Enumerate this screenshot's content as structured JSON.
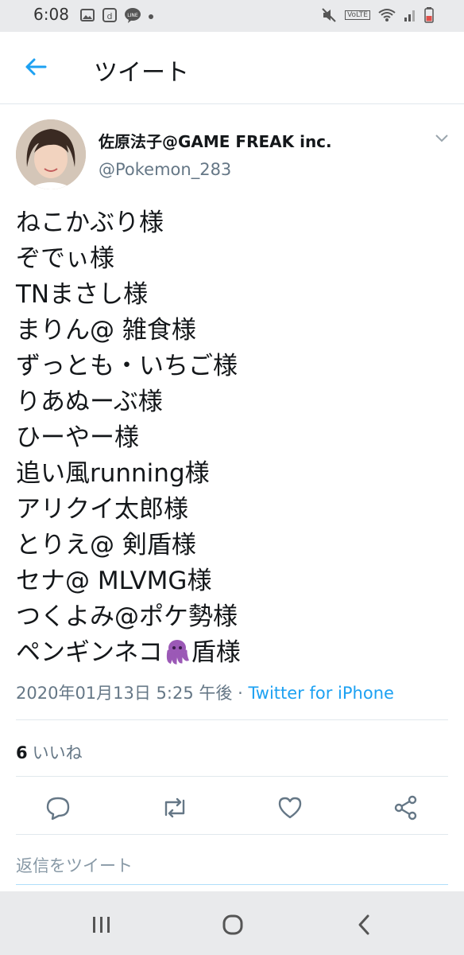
{
  "status_bar": {
    "time": "6:08",
    "left_icons": [
      "image-icon",
      "d-app-icon",
      "line-app-icon",
      "dot-icon"
    ],
    "right_icons": [
      "mute-icon",
      "volte-icon",
      "wifi-icon",
      "signal-icon",
      "battery-icon"
    ],
    "volte_label": "VoLTE"
  },
  "app_bar": {
    "title": "ツイート"
  },
  "tweet": {
    "author_name": "佐原法子@GAME FREAK inc.",
    "author_handle": "@Pokemon_283",
    "lines": [
      "ねこかぶり様",
      "ぞでぃ様",
      "TNまさし様",
      "まりん@ 雑食様",
      "ずっとも・いちご様",
      "りあぬーぶ様",
      "ひーやー様",
      "追い風running様",
      "アリクイ太郎様",
      "とりえ@ 剣盾様",
      "セナ@ MLVMG様",
      "つくよみ@ポケ勢様"
    ],
    "last_line_before_emoji": "ペンギンネコ",
    "last_line_after_emoji": "盾様",
    "emoji": "octopus-emoji",
    "timestamp": "2020年01月13日 5:25 午後",
    "separator": " · ",
    "source": "Twitter for iPhone",
    "like_count": "6",
    "like_label": "いいね"
  },
  "actions": [
    "reply-icon",
    "retweet-icon",
    "like-icon",
    "share-icon"
  ],
  "reply_placeholder": "返信をツイート",
  "nav_bar": [
    "recent-apps-icon",
    "home-icon",
    "back-icon"
  ],
  "colors": {
    "accent": "#1da1f2",
    "text": "#14171a",
    "secondary": "#657786",
    "emoji": "#9b59b6"
  }
}
